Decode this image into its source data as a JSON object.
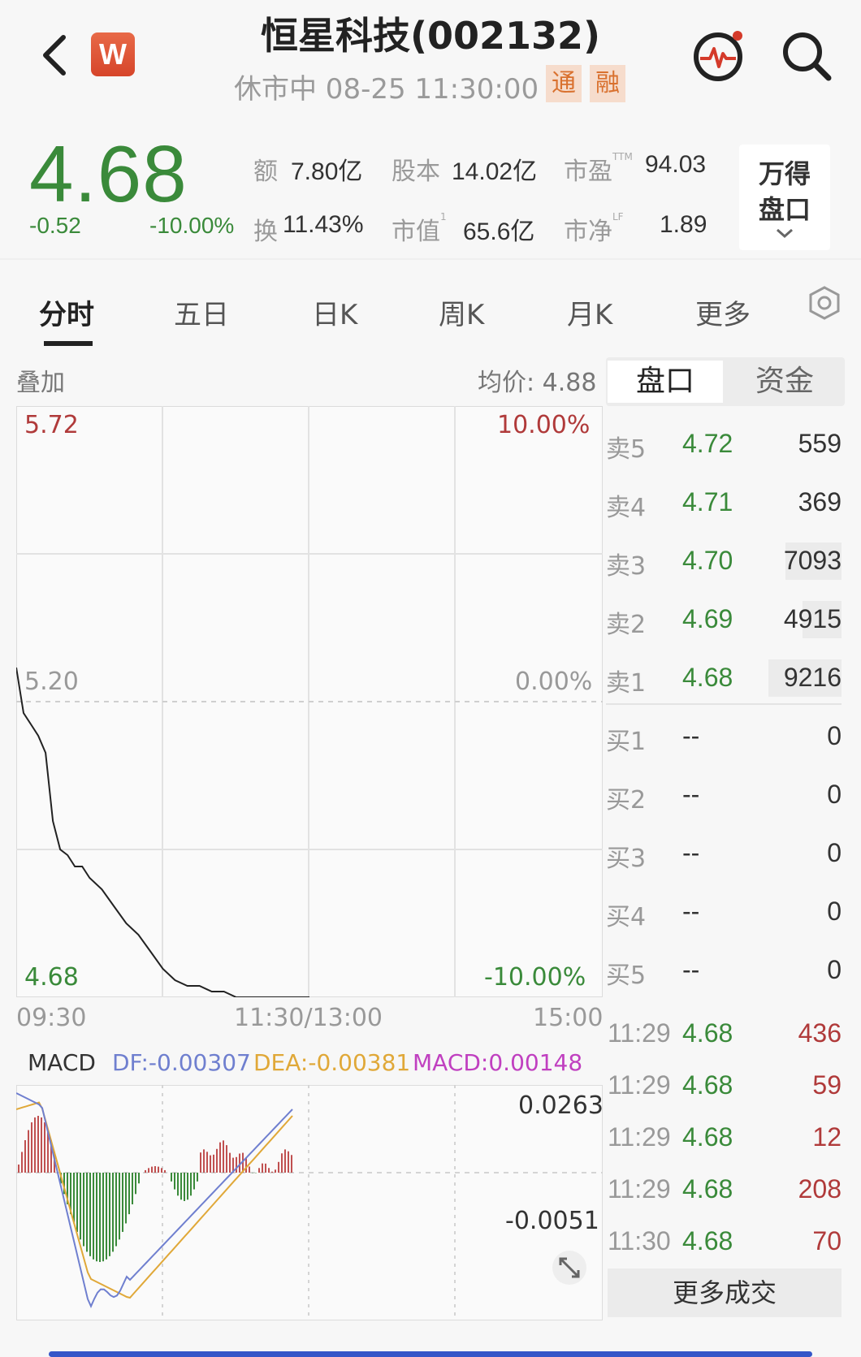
{
  "header": {
    "title": "恒星科技(002132)",
    "status": "休市中 08-25 11:30:00",
    "tag_tong": "通",
    "tag_rong": "融",
    "logo_letter": "W",
    "icons": {
      "back": "chevron-left-icon",
      "logo": "wind-logo-icon",
      "pulse": "pulse-monitor-icon",
      "search": "search-icon"
    }
  },
  "quote": {
    "price": "4.68",
    "change": "-0.52",
    "change_pct": "-10.00%",
    "stats": [
      {
        "label": "额",
        "value": "7.80亿"
      },
      {
        "label": "股本",
        "value": "14.02亿"
      },
      {
        "label": "市盈",
        "sup": "TTM",
        "value": "94.03"
      },
      {
        "label": "换",
        "value": "11.43%"
      },
      {
        "label": "市值",
        "sup": "1",
        "value": "65.6亿"
      },
      {
        "label": "市净",
        "sup": "LF",
        "value": "1.89"
      }
    ],
    "wande_line1": "万得",
    "wande_line2": "盘口"
  },
  "tabs": [
    "分时",
    "五日",
    "日K",
    "周K",
    "月K",
    "更多"
  ],
  "active_tab": 0,
  "chart": {
    "overlay_label": "叠加",
    "avg_price": "均价: 4.88",
    "y_top": "5.72",
    "y_mid": "5.20",
    "y_bot": "4.68",
    "pct_top": "10.00%",
    "pct_mid": "0.00%",
    "pct_bot": "-10.00%",
    "x_labels": [
      "09:30",
      "11:30/13:00",
      "15:00"
    ]
  },
  "chart_data": {
    "type": "line",
    "x": [
      "09:30",
      "09:33",
      "09:36",
      "09:39",
      "09:42",
      "09:45",
      "09:48",
      "09:51",
      "09:54",
      "09:57",
      "10:00",
      "10:05",
      "10:10",
      "10:15",
      "10:20",
      "10:25",
      "10:30",
      "10:35",
      "10:40",
      "10:45",
      "10:50",
      "10:55",
      "11:00",
      "11:05",
      "11:10",
      "11:15",
      "11:20",
      "11:25",
      "11:30"
    ],
    "series": [
      {
        "values": [
          5.26,
          5.18,
          5.16,
          5.14,
          5.11,
          4.99,
          4.94,
          4.93,
          4.91,
          4.91,
          4.89,
          4.87,
          4.84,
          4.81,
          4.79,
          4.76,
          4.73,
          4.71,
          4.7,
          4.7,
          4.69,
          4.69,
          4.68,
          4.68,
          4.68,
          4.68,
          4.68,
          4.68,
          4.68
        ]
      }
    ],
    "ylim": [
      4.68,
      5.72
    ],
    "xlim": [
      "09:30",
      "15:00"
    ],
    "grid": true
  },
  "macd": {
    "label": "MACD",
    "df": "DF:-0.00307",
    "dea": "DEA:-0.00381",
    "macd": "MACD:0.00148",
    "y_top": "0.0263",
    "y_bot": "-0.0051",
    "colors": {
      "df": "#6f7fcf",
      "dea": "#e0a838",
      "macd": "#c040c0",
      "up": "#c05050",
      "down": "#3a8a3a"
    }
  },
  "orderbook": {
    "tabs": [
      "盘口",
      "资金"
    ],
    "active_tab": 0,
    "asks": [
      {
        "label": "卖5",
        "price": "4.72",
        "vol": "559",
        "bar": 0.06
      },
      {
        "label": "卖4",
        "price": "4.71",
        "vol": "369",
        "bar": 0.04
      },
      {
        "label": "卖3",
        "price": "4.70",
        "vol": "7093",
        "bar": 0.77
      },
      {
        "label": "卖2",
        "price": "4.69",
        "vol": "4915",
        "bar": 0.53
      },
      {
        "label": "卖1",
        "price": "4.68",
        "vol": "9216",
        "bar": 1.0
      }
    ],
    "bids": [
      {
        "label": "买1",
        "price": "--",
        "vol": "0"
      },
      {
        "label": "买2",
        "price": "--",
        "vol": "0"
      },
      {
        "label": "买3",
        "price": "--",
        "vol": "0"
      },
      {
        "label": "买4",
        "price": "--",
        "vol": "0"
      },
      {
        "label": "买5",
        "price": "--",
        "vol": "0"
      }
    ]
  },
  "trades": [
    {
      "time": "11:29",
      "price": "4.68",
      "vol": "436"
    },
    {
      "time": "11:29",
      "price": "4.68",
      "vol": "59"
    },
    {
      "time": "11:29",
      "price": "4.68",
      "vol": "12"
    },
    {
      "time": "11:29",
      "price": "4.68",
      "vol": "208"
    },
    {
      "time": "11:30",
      "price": "4.68",
      "vol": "70"
    }
  ],
  "more_trades": "更多成交",
  "colors": {
    "down": "#3a8a3a",
    "up": "#b03a3a",
    "accent_tag_bg": "#f6dccc",
    "accent_tag_fg": "#d9712f"
  }
}
